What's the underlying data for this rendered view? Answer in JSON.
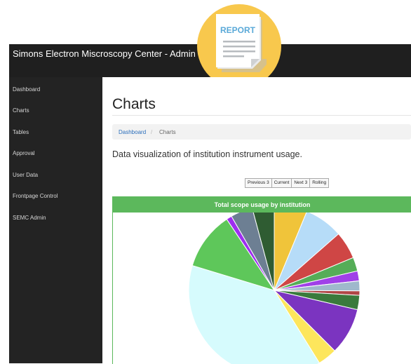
{
  "app": {
    "title": "Simons Electron Miscroscopy Center - Admin"
  },
  "badge": {
    "label": "REPORT"
  },
  "sidebar": {
    "items": [
      {
        "label": "Dashboard"
      },
      {
        "label": "Charts"
      },
      {
        "label": "Tables"
      },
      {
        "label": "Approval"
      },
      {
        "label": "User Data"
      },
      {
        "label": "Frontpage Control"
      },
      {
        "label": "SEMC Admin"
      }
    ]
  },
  "page": {
    "title": "Charts",
    "breadcrumb": {
      "link": "Dashboard",
      "separator": "/",
      "current": "Charts"
    },
    "description": "Data visualization of institution instrument usage."
  },
  "range_buttons": [
    {
      "label": "Previous 3"
    },
    {
      "label": "Current"
    },
    {
      "label": "Next 3"
    },
    {
      "label": "Rolling"
    }
  ],
  "panel": {
    "title": "Total scope usage by institution"
  },
  "colors": {
    "topbar": "#1f1f1f",
    "sidebar": "#232323",
    "panel_green": "#5cb85c",
    "link": "#2a6ebb",
    "badge_yellow": "#f8c84d"
  },
  "chart_data": {
    "type": "pie",
    "title": "Total scope usage by institution",
    "slices": [
      {
        "value": 6.0,
        "color": "#f0c43a"
      },
      {
        "value": 7.0,
        "color": "#b6dcf8"
      },
      {
        "value": 5.0,
        "color": "#cf4645"
      },
      {
        "value": 2.5,
        "color": "#55ad57"
      },
      {
        "value": 1.8,
        "color": "#a040e8"
      },
      {
        "value": 1.8,
        "color": "#9fb8cc"
      },
      {
        "value": 0.8,
        "color": "#b04646"
      },
      {
        "value": 2.6,
        "color": "#3a7a3c"
      },
      {
        "value": 8.5,
        "color": "#7b34c0"
      },
      {
        "value": 3.5,
        "color": "#fde65c"
      },
      {
        "value": 37.0,
        "color": "#d6fbfd"
      },
      {
        "value": 10.5,
        "color": "#5ec75a"
      },
      {
        "value": 1.0,
        "color": "#9e2ef0"
      },
      {
        "value": 4.0,
        "color": "#6d7f93"
      },
      {
        "value": 4.0,
        "color": "#2f5c32"
      }
    ]
  }
}
